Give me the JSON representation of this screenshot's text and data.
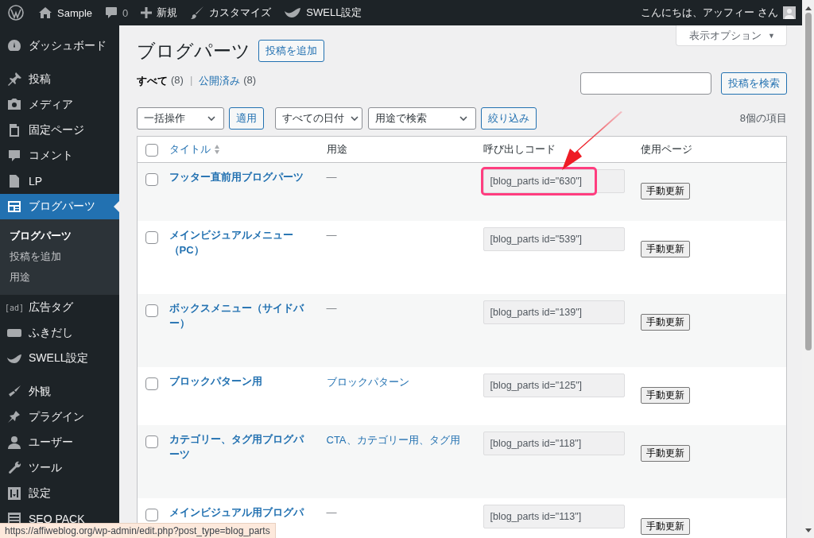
{
  "admin_bar": {
    "items": [
      {
        "label": "Sample"
      },
      {
        "label": "0"
      },
      {
        "label": "新規"
      },
      {
        "label": "カスタマイズ"
      },
      {
        "label": "SWELL設定"
      }
    ],
    "greeting": "こんにちは、アッフィー さん"
  },
  "sidebar": {
    "groups": [
      [
        {
          "label": "ダッシュボード",
          "selected": false
        }
      ],
      [
        {
          "label": "投稿",
          "selected": false
        },
        {
          "label": "メディア",
          "selected": false
        },
        {
          "label": "固定ページ",
          "selected": false
        },
        {
          "label": "コメント",
          "selected": false
        },
        {
          "label": "LP",
          "selected": false
        },
        {
          "label": "ブログパーツ",
          "selected": true,
          "children": [
            {
              "label": "ブログパーツ",
              "selected": true
            },
            {
              "label": "投稿を追加",
              "selected": false
            },
            {
              "label": "用途",
              "selected": false
            }
          ]
        },
        {
          "label": "広告タグ",
          "icon_text": "[ad]",
          "selected": false
        },
        {
          "label": "ふきだし",
          "selected": false
        },
        {
          "label": "SWELL設定",
          "selected": false
        }
      ],
      [
        {
          "label": "外観",
          "selected": false
        },
        {
          "label": "プラグイン",
          "selected": false
        },
        {
          "label": "ユーザー",
          "selected": false
        },
        {
          "label": "ツール",
          "selected": false
        },
        {
          "label": "設定",
          "selected": false
        },
        {
          "label": "SEO PACK",
          "selected": false
        }
      ]
    ]
  },
  "page": {
    "title": "ブログパーツ",
    "add_button": "投稿を追加",
    "screen_options": "表示オプション",
    "screen_options_caret": "▼",
    "views": [
      {
        "label": "すべて",
        "count": "(8)",
        "selected": true
      },
      {
        "label": "公開済み",
        "count": "(8)",
        "selected": false
      }
    ],
    "view_separator": "|",
    "search_button": "投稿を検索",
    "bulk_select": "一括操作",
    "apply_button": "適用",
    "date_select": "すべての日付",
    "usage_select": "用途で検索",
    "filter_button": "絞り込み",
    "item_count": "8個の項目"
  },
  "table": {
    "select_all_checked": false,
    "columns": [
      {
        "label": "タイトル",
        "sortable": true
      },
      {
        "label": "用途",
        "sortable": false
      },
      {
        "label": "呼び出しコード",
        "sortable": false
      },
      {
        "label": "使用ページ",
        "sortable": false
      }
    ],
    "rows": [
      {
        "checked": false,
        "title": "フッター直前用ブログパーツ",
        "usage": "—",
        "usage_link": false,
        "code": "[blog_parts id=\"630\"]",
        "highlighted": true,
        "update_button": "手動更新"
      },
      {
        "checked": false,
        "title": "メインビジュアルメニュー（PC）",
        "usage": "—",
        "usage_link": false,
        "code": "[blog_parts id=\"539\"]",
        "highlighted": false,
        "update_button": "手動更新"
      },
      {
        "checked": false,
        "title": "ボックスメニュー（サイドバー）",
        "usage": "—",
        "usage_link": false,
        "code": "[blog_parts id=\"139\"]",
        "highlighted": false,
        "update_button": "手動更新"
      },
      {
        "checked": false,
        "title": "ブロックパターン用",
        "usage": "ブロックパターン",
        "usage_link": true,
        "code": "[blog_parts id=\"125\"]",
        "highlighted": false,
        "update_button": "手動更新"
      },
      {
        "checked": false,
        "title": "カテゴリー、タグ用ブログパーツ",
        "usage": "CTA、カテゴリー用、タグ用",
        "usage_link": true,
        "code": "[blog_parts id=\"118\"]",
        "highlighted": false,
        "update_button": "手動更新"
      },
      {
        "checked": false,
        "title": "メインビジュアル用ブログパ",
        "usage": "—",
        "usage_link": false,
        "code": "[blog_parts id=\"113\"]",
        "highlighted": false,
        "update_button": "手動更新"
      }
    ]
  },
  "status_url": "https://affiweblog.org/wp-admin/edit.php?post_type=blog_parts"
}
